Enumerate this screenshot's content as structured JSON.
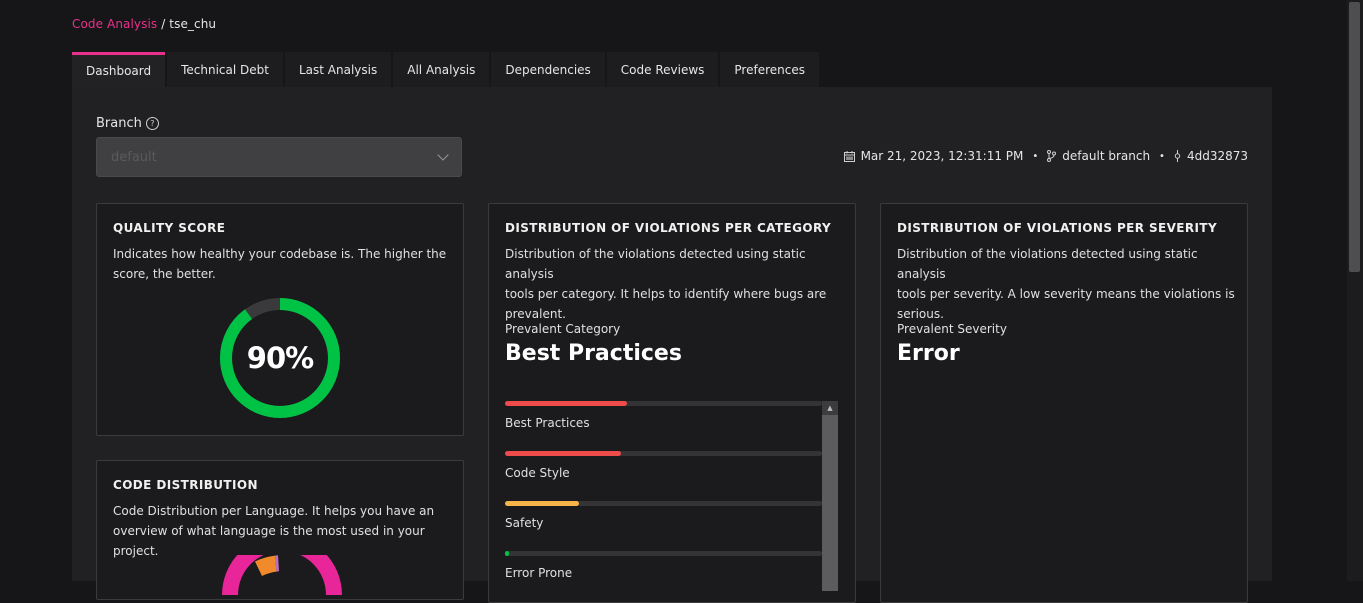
{
  "breadcrumb": {
    "link": "Code Analysis",
    "separator": "/",
    "current": "tse_chu"
  },
  "tabs": [
    {
      "label": "Dashboard",
      "active": true
    },
    {
      "label": "Technical Debt"
    },
    {
      "label": "Last Analysis"
    },
    {
      "label": "All Analysis"
    },
    {
      "label": "Dependencies"
    },
    {
      "label": "Code Reviews"
    },
    {
      "label": "Preferences"
    }
  ],
  "branch": {
    "label": "Branch",
    "help_icon": "?",
    "selected": "default"
  },
  "meta": {
    "date": "Mar 21, 2023, 12:31:11 PM",
    "branch": "default branch",
    "commit": "4dd32873",
    "separator": "•"
  },
  "quality": {
    "title": "QUALITY SCORE",
    "description_line1": "Indicates how healthy your codebase is. The higher the",
    "description_line2": "score, the better.",
    "score_text": "90%",
    "score_fraction": 0.9,
    "ring_color": "#00c244"
  },
  "code_distribution": {
    "title": "CODE DISTRIBUTION",
    "description_line1": "Code Distribution per Language. It helps you have an",
    "description_line2": "overview of what language is the most used in your project."
  },
  "category": {
    "title": "DISTRIBUTION OF VIOLATIONS PER CATEGORY",
    "description_line1": "Distribution of the violations detected using static analysis",
    "description_line2": "tools per category. It helps to identify where bugs are",
    "description_line3": "prevalent.",
    "prevalent_label": "Prevalent Category",
    "prevalent_value": "Best Practices",
    "items": [
      {
        "label": "Best Practices",
        "fraction": 0.385,
        "color": "#ee4b4b"
      },
      {
        "label": "Code Style",
        "fraction": 0.365,
        "color": "#ee4b4b"
      },
      {
        "label": "Safety",
        "fraction": 0.235,
        "color": "#f7b54a"
      },
      {
        "label": "Error Prone",
        "fraction": 0.012,
        "color": "#00c244"
      }
    ]
  },
  "severity": {
    "title": "DISTRIBUTION OF VIOLATIONS PER SEVERITY",
    "description_line1": "Distribution of the violations detected using static analysis",
    "description_line2": "tools per severity. A low severity means the violations is",
    "description_line3": "serious.",
    "prevalent_label": "Prevalent Severity",
    "prevalent_value": "Error"
  }
}
